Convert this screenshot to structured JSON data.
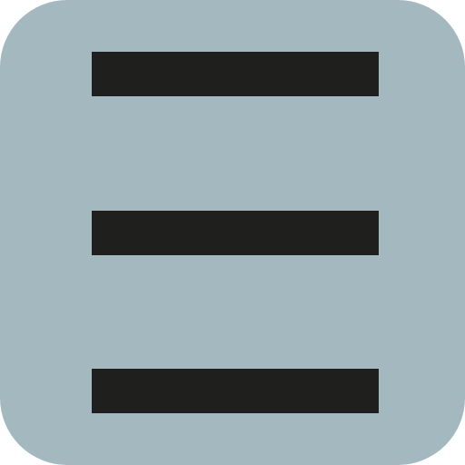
{
  "icon": {
    "name": "hamburger-menu-icon",
    "background_color": "#a4b9bf",
    "bar_color": "#1f1f1d",
    "bars": [
      "top",
      "middle",
      "bottom"
    ]
  }
}
